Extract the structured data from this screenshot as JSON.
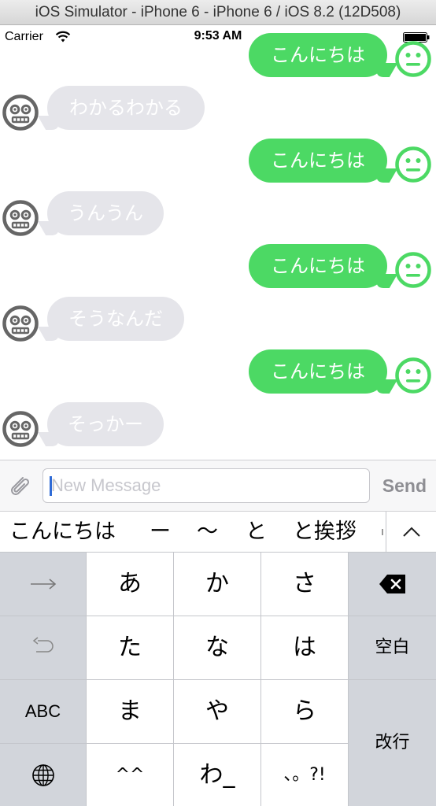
{
  "window": {
    "title": "iOS Simulator - iPhone 6 - iPhone 6 / iOS 8.2 (12D508)"
  },
  "status_bar": {
    "carrier": "Carrier",
    "time": "9:53 AM",
    "icons": [
      "wifi-icon",
      "battery-icon"
    ]
  },
  "messages": [
    {
      "direction": "outgoing",
      "text": "こんにちは"
    },
    {
      "direction": "incoming",
      "text": "わかるわかる"
    },
    {
      "direction": "outgoing",
      "text": "こんにちは"
    },
    {
      "direction": "incoming",
      "text": "うんうん"
    },
    {
      "direction": "outgoing",
      "text": "こんにちは"
    },
    {
      "direction": "incoming",
      "text": "そうなんだ"
    },
    {
      "direction": "outgoing",
      "text": "こんにちは"
    },
    {
      "direction": "incoming",
      "text": "そっかー"
    }
  ],
  "composer": {
    "placeholder": "New Message",
    "send_label": "Send",
    "attach_icon": "paperclip-icon"
  },
  "predictions": [
    "こんにちは",
    "ー",
    "〜",
    "と",
    "と挨拶"
  ],
  "keyboard": {
    "rows": [
      [
        "→",
        "あ",
        "か",
        "さ",
        "⌫"
      ],
      [
        "↺",
        "た",
        "な",
        "は",
        "空白"
      ],
      [
        "ABC",
        "ま",
        "や",
        "ら",
        "改行"
      ],
      [
        "🌐",
        "^^",
        "わ_",
        "、。?!"
      ]
    ],
    "keys": {
      "next": "→",
      "a": "あ",
      "ka": "か",
      "sa": "さ",
      "undo": "↺",
      "ta": "た",
      "na": "な",
      "ha": "は",
      "space": "空白",
      "abc": "ABC",
      "ma": "ま",
      "ya": "や",
      "ra": "ら",
      "return": "改行",
      "emoticon": "^^",
      "wa": "わ_",
      "punct": "、。?!"
    }
  },
  "colors": {
    "outgoing_bubble": "#4cd964",
    "incoming_bubble": "#e5e5ea",
    "avatar_out": "#4cd964",
    "avatar_in": "#666666"
  }
}
